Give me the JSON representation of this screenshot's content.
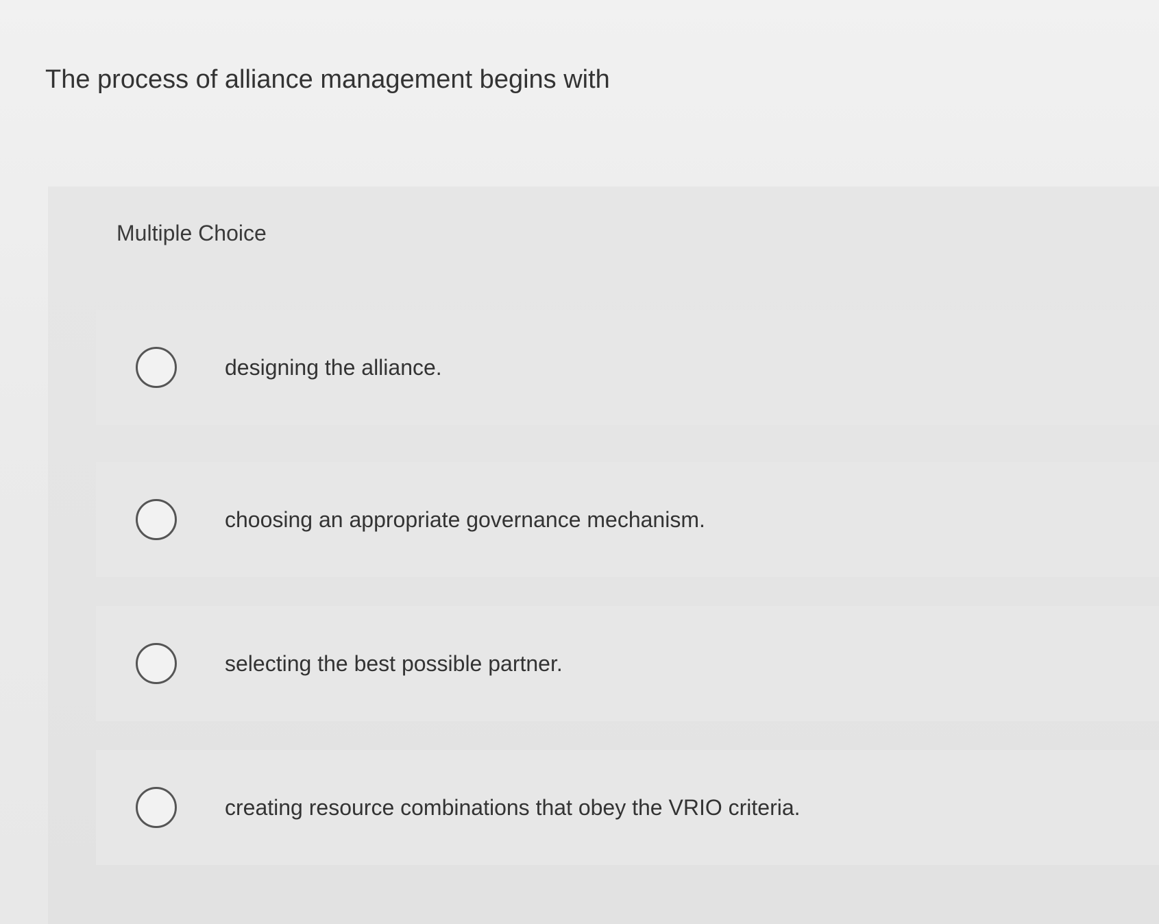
{
  "question": {
    "text": "The process of alliance management begins with"
  },
  "answer_panel": {
    "header": "Multiple Choice",
    "options": [
      {
        "label": "designing the alliance.",
        "selected": false
      },
      {
        "label": "choosing an appropriate governance mechanism.",
        "selected": false
      },
      {
        "label": "selecting the best possible partner.",
        "selected": false
      },
      {
        "label": "creating resource combinations that obey the VRIO criteria.",
        "selected": false
      }
    ]
  }
}
